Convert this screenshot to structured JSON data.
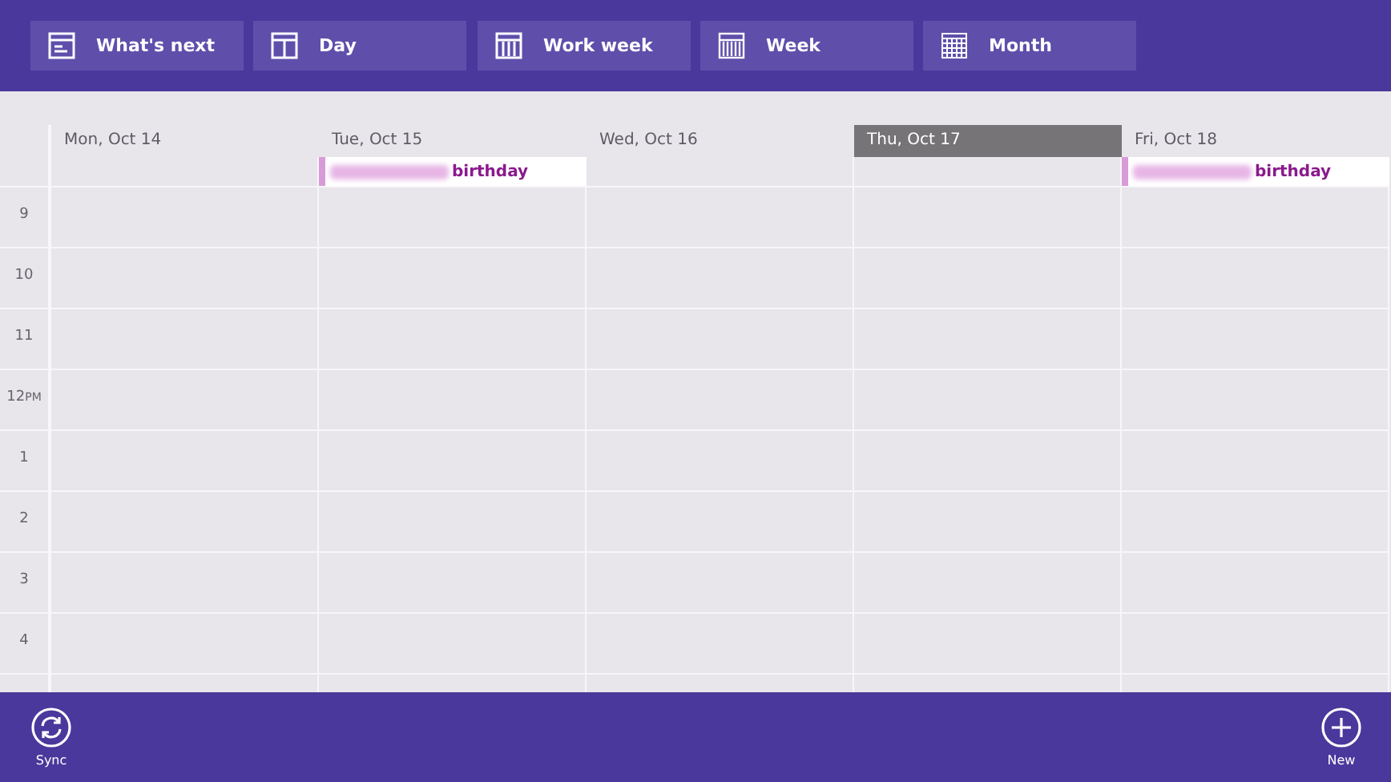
{
  "view_buttons": [
    {
      "label": "What's next",
      "kind": "whats-next"
    },
    {
      "label": "Day",
      "kind": "day"
    },
    {
      "label": "Work week",
      "kind": "work-week"
    },
    {
      "label": "Week",
      "kind": "week"
    },
    {
      "label": "Month",
      "kind": "month"
    }
  ],
  "days": [
    {
      "label": "Mon, Oct 14",
      "selected": false
    },
    {
      "label": "Tue, Oct 15",
      "selected": false,
      "events": [
        {
          "text": "birthday"
        }
      ]
    },
    {
      "label": "Wed, Oct 16",
      "selected": false
    },
    {
      "label": "Thu, Oct 17",
      "selected": true
    },
    {
      "label": "Fri, Oct 18",
      "selected": false,
      "events": [
        {
          "text": "birthday"
        }
      ]
    }
  ],
  "hours": [
    {
      "label": "9"
    },
    {
      "label": "10"
    },
    {
      "label": "11"
    },
    {
      "label": "12",
      "suffix": "PM"
    },
    {
      "label": "1"
    },
    {
      "label": "2"
    },
    {
      "label": "3"
    },
    {
      "label": "4"
    }
  ],
  "commands": [
    {
      "label": "Sync",
      "kind": "sync"
    },
    {
      "label": "New",
      "kind": "new"
    }
  ]
}
